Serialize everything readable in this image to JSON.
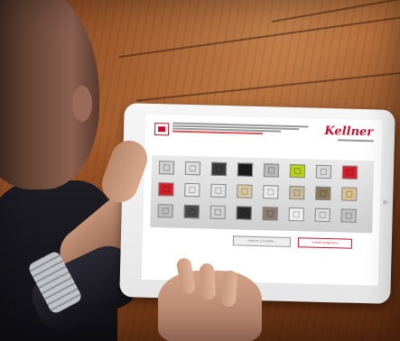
{
  "screen": {
    "logo_text": "Kellner",
    "button_secondary": "Weiterhin zum EMRE...",
    "button_primary": "Schalter konfigurieren"
  },
  "swatches": [
    [
      "#cfcfcf",
      "#dcdcdc",
      "#3a3a3a",
      "#1c1c1c",
      "#b8b8b8",
      "#b7cf1e",
      "#d8d8d8",
      "#d21f2a"
    ],
    [
      "#d21f2a",
      "#e6e6e6",
      "#e2e2e2",
      "#d9c9a3",
      "#ebebeb",
      "#c9b99a",
      "#8a7a5a",
      "#d8c28e"
    ],
    [
      "#bdbdbd",
      "#4a4a4a",
      "#cfcfcf",
      "#2a2a2a",
      "#8a7d6e",
      "#efefef",
      "#dadada",
      "#c0c0c0"
    ]
  ],
  "colors": {
    "brand_red": "#c8102e"
  }
}
